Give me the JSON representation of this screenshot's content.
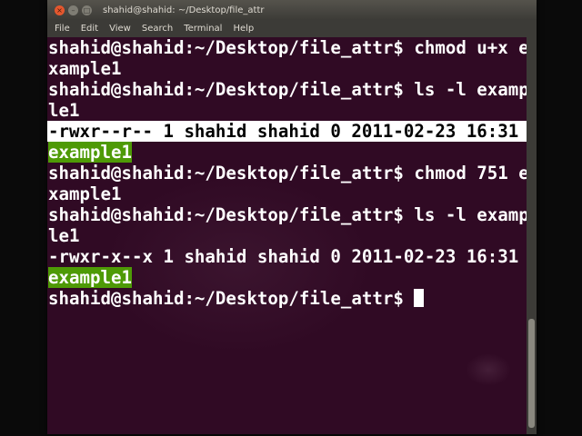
{
  "window": {
    "title": "shahid@shahid: ~/Desktop/file_attr",
    "buttons": {
      "close": "×",
      "minimize": "–",
      "maximize": "□"
    }
  },
  "menu": {
    "file": "File",
    "edit": "Edit",
    "view": "View",
    "search": "Search",
    "terminal": "Terminal",
    "help": "Help"
  },
  "terminal": {
    "lines": [
      "shahid@shahid:~/Desktop/file_attr$ chmod u+x e",
      "xample1",
      "shahid@shahid:~/Desktop/file_attr$ ls -l examp",
      "le1",
      "-rwxr--r-- 1 shahid shahid 0 2011-02-23 16:31 ",
      "example1",
      "shahid@shahid:~/Desktop/file_attr$ chmod 751 e",
      "xample1",
      "shahid@shahid:~/Desktop/file_attr$ ls -l examp",
      "le1",
      "-rwxr-x--x 1 shahid shahid 0 2011-02-23 16:31 ",
      "example1",
      "shahid@shahid:~/Desktop/file_attr$ "
    ]
  },
  "colors": {
    "terminal_bg": "#300a24",
    "text": "#ffffff",
    "filename_bg": "#4e9a06",
    "highlight_bg": "#ffffff",
    "titlebar": "#3c3b37",
    "close_button": "#e4572e"
  }
}
